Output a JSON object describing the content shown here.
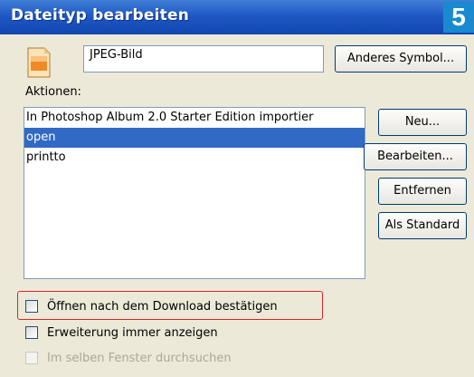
{
  "window": {
    "title": "Dateityp bearbeiten",
    "step_badge": "5"
  },
  "file_type": {
    "icon": "jpeg-file-icon",
    "name_value": "JPEG-Bild",
    "change_icon_label": "Anderes Symbol..."
  },
  "actions": {
    "label": "Aktionen:",
    "items": [
      {
        "label": "In Photoshop Album 2.0 Starter Edition importier",
        "selected": false
      },
      {
        "label": "open",
        "selected": true
      },
      {
        "label": "printto",
        "selected": false
      }
    ]
  },
  "buttons": {
    "new": "Neu...",
    "edit": "Bearbeiten...",
    "remove": "Entfernen",
    "default": "Als Standard"
  },
  "options": [
    {
      "label": "Öffnen nach dem Download bestätigen",
      "checked": false,
      "enabled": true,
      "highlighted": true
    },
    {
      "label": "Erweiterung immer anzeigen",
      "checked": false,
      "enabled": true
    },
    {
      "label": "Im selben Fenster durchsuchen",
      "checked": false,
      "enabled": false
    }
  ],
  "colors": {
    "titlebar": "#1f58c4",
    "selection": "#316ac5",
    "highlight_frame": "#d9262b",
    "step_badge": "#1a8ad0"
  }
}
